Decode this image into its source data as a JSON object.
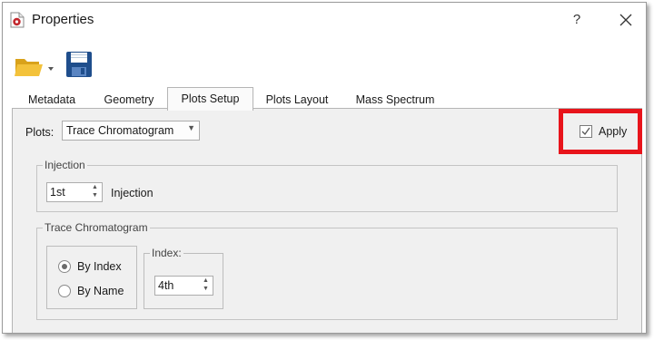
{
  "window": {
    "title": "Properties",
    "help_label": "?",
    "close_label": "✕"
  },
  "toolbar": {
    "open_icon": "folder-open-icon",
    "save_icon": "floppy-disk-icon"
  },
  "tabs": [
    {
      "label": "Metadata",
      "active": false
    },
    {
      "label": "Geometry",
      "active": false
    },
    {
      "label": "Plots Setup",
      "active": true
    },
    {
      "label": "Plots Layout",
      "active": false
    },
    {
      "label": "Mass Spectrum",
      "active": false
    }
  ],
  "plots": {
    "label": "Plots:",
    "selected": "Trace Chromatogram"
  },
  "apply": {
    "label": "Apply",
    "checked": true,
    "highlight_color": "#e8141b"
  },
  "injection": {
    "group_title": "Injection",
    "value": "1st",
    "suffix": "Injection"
  },
  "trace": {
    "group_title": "Trace Chromatogram",
    "by_index_label": "By Index",
    "by_name_label": "By Name",
    "selected": "By Index",
    "index_group_title": "Index:",
    "index_value": "4th"
  }
}
